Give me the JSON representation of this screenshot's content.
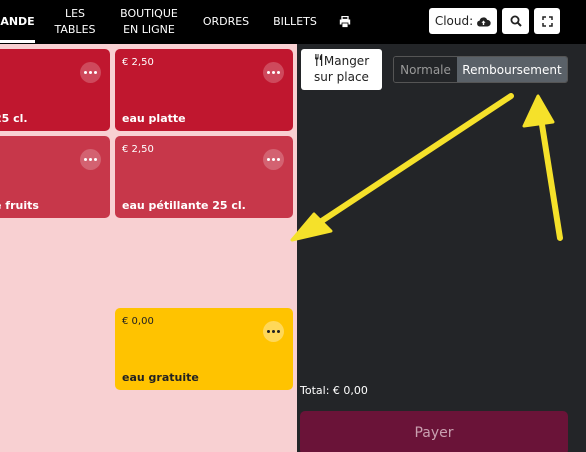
{
  "nav": {
    "items": [
      {
        "label": "ANDE"
      },
      {
        "label": "LES\nTABLES"
      },
      {
        "label": "BOUTIQUE\nEN LIGNE"
      },
      {
        "label": "ORDRES"
      },
      {
        "label": "BILLETS"
      }
    ]
  },
  "toolbar": {
    "cloud_label": "Cloud:"
  },
  "tiles": [
    {
      "price": "",
      "name": "25 cl.",
      "color": "#c0172f"
    },
    {
      "price": "€ 2,50",
      "name": "eau platte",
      "color": "#c0172f"
    },
    {
      "price": "",
      "name": "e fruits",
      "color": "#c7374a"
    },
    {
      "price": "€ 2,50",
      "name": "eau pétillante 25 cl.",
      "color": "#c7374a"
    },
    {
      "price": "€ 0,00",
      "name": "eau gratuite",
      "color": "#ffc300"
    }
  ],
  "order": {
    "manger_label": "Manger\nsur place",
    "mode_options": [
      "Normale",
      "Remboursement"
    ],
    "selected_mode": "Remboursement",
    "total_label": "Total: € 0,00",
    "pay_label": "Payer"
  },
  "colors": {
    "accent": "#f5e12a",
    "pay": "#6a1338",
    "panel": "#232528",
    "menu_bg": "#f8d0d2"
  }
}
